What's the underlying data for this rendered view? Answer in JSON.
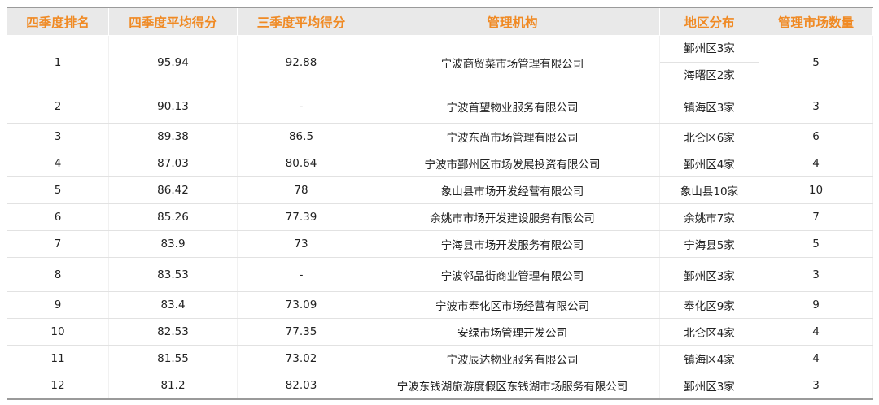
{
  "headers": [
    "四季度排名",
    "四季度平均得分",
    "三季度平均得分",
    "管理机构",
    "地区分布",
    "管理市场数量"
  ],
  "rows": [
    {
      "rank": "1",
      "q4": "95.94",
      "q3": "92.88",
      "org": "宁波商贸菜市场管理有限公司",
      "regions": [
        "鄞州区3家",
        "海曙区2家"
      ],
      "count": "5"
    },
    {
      "rank": "2",
      "q4": "90.13",
      "q3": "-",
      "org": "宁波首望物业服务有限公司",
      "regions": [
        "镇海区3家"
      ],
      "count": "3"
    },
    {
      "rank": "3",
      "q4": "89.38",
      "q3": "86.5",
      "org": "宁波东尚市场管理有限公司",
      "regions": [
        "北仑区6家"
      ],
      "count": "6"
    },
    {
      "rank": "4",
      "q4": "87.03",
      "q3": "80.64",
      "org": "宁波市鄞州区市场发展投资有限公司",
      "regions": [
        "鄞州区4家"
      ],
      "count": "4"
    },
    {
      "rank": "5",
      "q4": "86.42",
      "q3": "78",
      "org": "象山县市场开发经营有限公司",
      "regions": [
        "象山县10家"
      ],
      "count": "10"
    },
    {
      "rank": "6",
      "q4": "85.26",
      "q3": "77.39",
      "org": "余姚市市场开发建设服务有限公司",
      "regions": [
        "余姚市7家"
      ],
      "count": "7"
    },
    {
      "rank": "7",
      "q4": "83.9",
      "q3": "73",
      "org": "宁海县市场开发服务有限公司",
      "regions": [
        "宁海县5家"
      ],
      "count": "5"
    },
    {
      "rank": "8",
      "q4": "83.53",
      "q3": "-",
      "org": "宁波邻品街商业管理有限公司",
      "regions": [
        "鄞州区3家"
      ],
      "count": "3"
    },
    {
      "rank": "9",
      "q4": "83.4",
      "q3": "73.09",
      "org": "宁波市奉化区市场经营有限公司",
      "regions": [
        "奉化区9家"
      ],
      "count": "9"
    },
    {
      "rank": "10",
      "q4": "82.53",
      "q3": "77.35",
      "org": "安绿市场管理开发公司",
      "regions": [
        "北仑区4家"
      ],
      "count": "4"
    },
    {
      "rank": "11",
      "q4": "81.55",
      "q3": "73.02",
      "org": "宁波辰达物业服务有限公司",
      "regions": [
        "镇海区4家"
      ],
      "count": "4"
    },
    {
      "rank": "12",
      "q4": "81.2",
      "q3": "82.03",
      "org": "宁波东钱湖旅游度假区东钱湖市场服务有限公司",
      "regions": [
        "鄞州区3家"
      ],
      "count": "3"
    }
  ],
  "colors": {
    "header_text": "#f08a24",
    "header_bg": "#e9e9e9"
  }
}
